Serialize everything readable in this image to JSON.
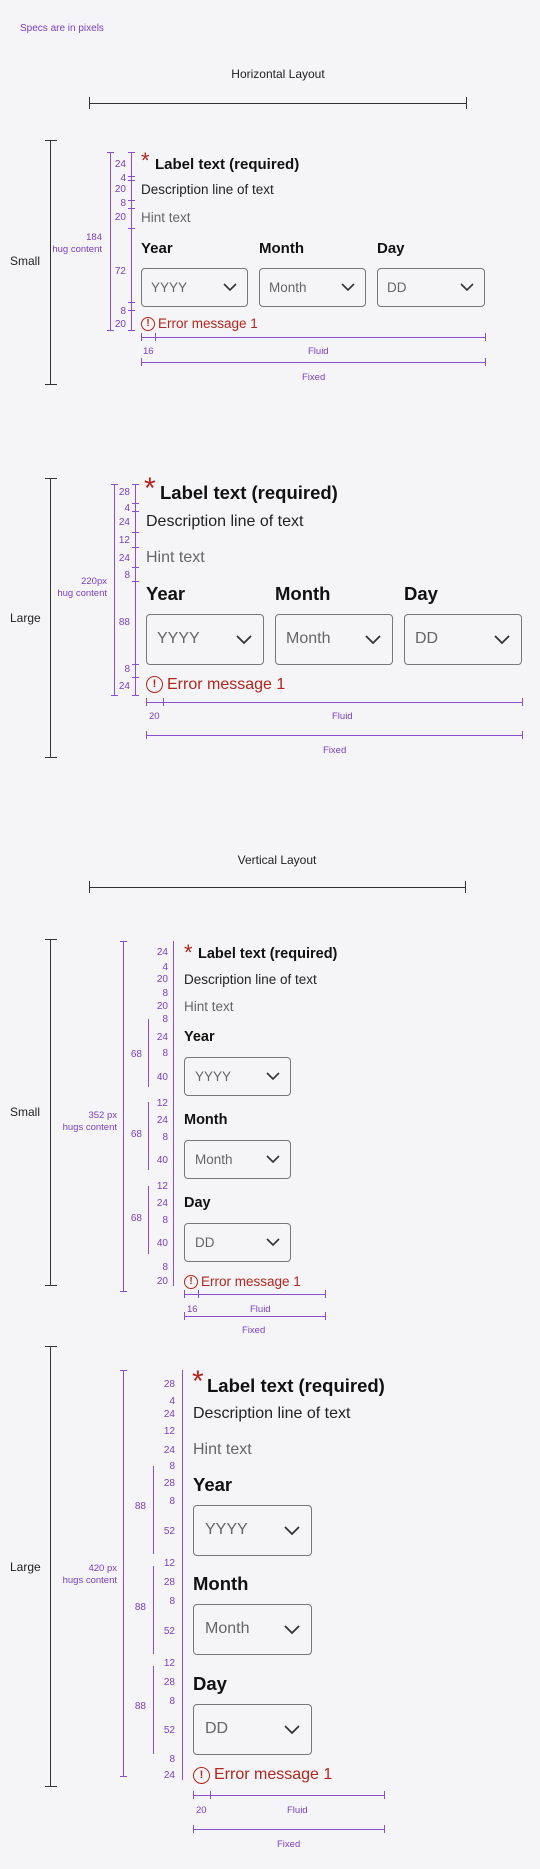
{
  "note": "Specs are in pixels",
  "horizontal": {
    "title": "Horizontal Layout",
    "small": {
      "size_label": "Small",
      "hug": [
        "184",
        "hug content"
      ],
      "spacing": [
        "24",
        "4",
        "20",
        "8",
        "20",
        "72",
        "8",
        "20"
      ],
      "label": "Label text (required)",
      "asterisk": "*",
      "description": "Description line of text",
      "hint": "Hint text",
      "fields": [
        {
          "label": "Year",
          "placeholder": "YYYY"
        },
        {
          "label": "Month",
          "placeholder": "Month"
        },
        {
          "label": "Day",
          "placeholder": "DD"
        }
      ],
      "error": "Error message 1",
      "error_icon": "!",
      "inset": "16",
      "fluid": "Fluid",
      "fixed": "Fixed"
    },
    "large": {
      "size_label": "Large",
      "hug": [
        "220px",
        "hug content"
      ],
      "spacing": [
        "28",
        "4",
        "24",
        "12",
        "24",
        "8",
        "88",
        "8",
        "24"
      ],
      "label": "Label text (required)",
      "asterisk": "*",
      "description": "Description line of text",
      "hint": "Hint text",
      "fields": [
        {
          "label": "Year",
          "placeholder": "YYYY"
        },
        {
          "label": "Month",
          "placeholder": "Month"
        },
        {
          "label": "Day",
          "placeholder": "DD"
        }
      ],
      "error": "Error message 1",
      "error_icon": "!",
      "inset": "20",
      "fluid": "Fluid",
      "fixed": "Fixed"
    }
  },
  "vertical": {
    "title": "Vertical Layout",
    "small": {
      "size_label": "Small",
      "hug": [
        "352 px",
        "hugs content"
      ],
      "spacing": [
        "24",
        "4",
        "20",
        "8",
        "20",
        "8",
        "24",
        "8",
        "40",
        "12",
        "24",
        "8",
        "40",
        "12",
        "24",
        "8",
        "40",
        "8",
        "20"
      ],
      "group": "68",
      "label": "Label text (required)",
      "asterisk": "*",
      "description": "Description line of text",
      "hint": "Hint text",
      "fields": [
        {
          "label": "Year",
          "placeholder": "YYYY"
        },
        {
          "label": "Month",
          "placeholder": "Month"
        },
        {
          "label": "Day",
          "placeholder": "DD"
        }
      ],
      "error": "Error message 1",
      "error_icon": "!",
      "inset": "16",
      "fluid": "Fluid",
      "fixed": "Fixed"
    },
    "large": {
      "size_label": "Large",
      "hug": [
        "420 px",
        "hugs content"
      ],
      "spacing": [
        "28",
        "4",
        "24",
        "12",
        "24",
        "8",
        "28",
        "8",
        "52",
        "12",
        "28",
        "8",
        "52",
        "12",
        "28",
        "8",
        "52",
        "8",
        "24"
      ],
      "group": "88",
      "label": "Label text (required)",
      "asterisk": "*",
      "description": "Description line of text",
      "hint": "Hint text",
      "fields": [
        {
          "label": "Year",
          "placeholder": "YYYY"
        },
        {
          "label": "Month",
          "placeholder": "Month"
        },
        {
          "label": "Day",
          "placeholder": "DD"
        }
      ],
      "error": "Error message 1",
      "error_icon": "!",
      "inset": "20",
      "fluid": "Fluid",
      "fixed": "Fixed"
    }
  },
  "colors": {
    "spec": "#7b3fc4",
    "error": "#b3261e"
  }
}
